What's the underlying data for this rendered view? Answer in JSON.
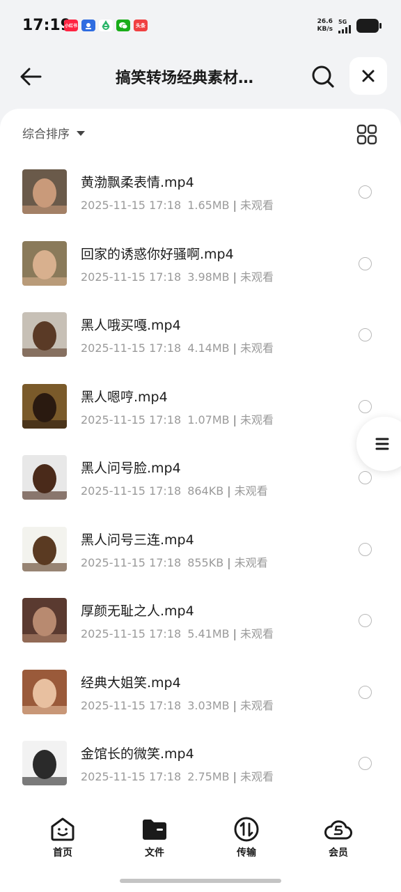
{
  "status_bar": {
    "time": "17:19",
    "apps": [
      {
        "icon": "xiaohongshu-icon",
        "text": "小红书",
        "color": "#ff2442"
      },
      {
        "icon": "baidu-map-icon",
        "text": "",
        "color": "#2f6de1"
      },
      {
        "icon": "recycle-icon",
        "text": "",
        "color": "#2bb66a"
      },
      {
        "icon": "wechat-icon",
        "text": "",
        "color": "#1aad19"
      },
      {
        "icon": "toutiao-icon",
        "text": "头条",
        "color": "#f04142"
      }
    ],
    "net_speed_value": "26.6",
    "net_speed_unit": "KB/s",
    "network": "5G"
  },
  "header": {
    "title": "搞笑转场经典素材…"
  },
  "toolbar": {
    "sort_label": "综合排序"
  },
  "files": [
    {
      "name": "黄渤飘柔表情.mp4",
      "date": "2025-11-15 17:18",
      "size": "1.65MB",
      "status": "未观看",
      "thumb_bg": "#6a5a4a",
      "thumb_fg": "#c99a7a"
    },
    {
      "name": "回家的诱惑你好骚啊.mp4",
      "date": "2025-11-15 17:18",
      "size": "3.98MB",
      "status": "未观看",
      "thumb_bg": "#8a7a5a",
      "thumb_fg": "#d8b08e"
    },
    {
      "name": "黑人哦买嘎.mp4",
      "date": "2025-11-15 17:18",
      "size": "4.14MB",
      "status": "未观看",
      "thumb_bg": "#c7c0b6",
      "thumb_fg": "#5a3a26"
    },
    {
      "name": "黑人嗯哼.mp4",
      "date": "2025-11-15 17:18",
      "size": "1.07MB",
      "status": "未观看",
      "thumb_bg": "#7a5a2a",
      "thumb_fg": "#2a1a10"
    },
    {
      "name": "黑人问号脸.mp4",
      "date": "2025-11-15 17:18",
      "size": "864KB",
      "status": "未观看",
      "thumb_bg": "#e8e8e8",
      "thumb_fg": "#4a2a1a"
    },
    {
      "name": "黑人问号三连.mp4",
      "date": "2025-11-15 17:18",
      "size": "855KB",
      "status": "未观看",
      "thumb_bg": "#f3f3ee",
      "thumb_fg": "#5a3a22"
    },
    {
      "name": "厚颜无耻之人.mp4",
      "date": "2025-11-15 17:18",
      "size": "5.41MB",
      "status": "未观看",
      "thumb_bg": "#5a3a30",
      "thumb_fg": "#b88a70"
    },
    {
      "name": "经典大姐笑.mp4",
      "date": "2025-11-15 17:18",
      "size": "3.03MB",
      "status": "未观看",
      "thumb_bg": "#9a5a3a",
      "thumb_fg": "#e8c0a0"
    },
    {
      "name": "金馆长的微笑.mp4",
      "date": "2025-11-15 17:18",
      "size": "2.75MB",
      "status": "未观看",
      "thumb_bg": "#f2f2f2",
      "thumb_fg": "#2a2a2a"
    }
  ],
  "nav": {
    "items": [
      {
        "label": "首页",
        "icon": "home-face-icon"
      },
      {
        "label": "文件",
        "icon": "folder-icon"
      },
      {
        "label": "传输",
        "icon": "transfer-icon"
      },
      {
        "label": "会员",
        "icon": "vip-cloud-icon"
      }
    ]
  },
  "colors": {
    "page_bg": "#f2f3f5",
    "panel_bg": "#ffffff",
    "text_primary": "#1c1c1c",
    "text_secondary": "#9a9a9a"
  }
}
